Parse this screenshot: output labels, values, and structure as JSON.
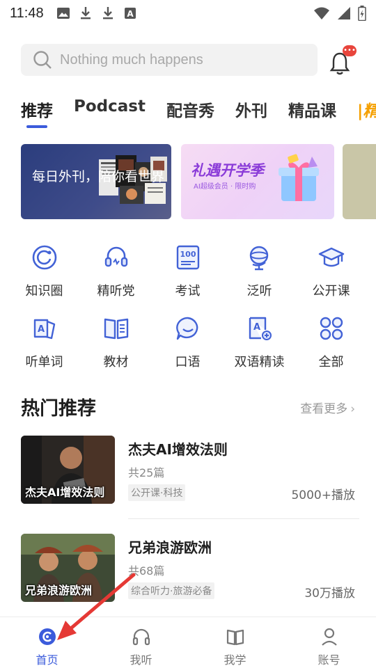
{
  "status_bar": {
    "time": "11:48",
    "icons": [
      "image-icon",
      "download-icon",
      "download-icon",
      "font-icon",
      "wifi-icon",
      "signal-icon",
      "battery-icon"
    ]
  },
  "search": {
    "placeholder": "Nothing much happens",
    "notification_badge": "•••"
  },
  "tabs": [
    {
      "label": "推荐",
      "active": true
    },
    {
      "label": "Podcast",
      "active": false
    },
    {
      "label": "配音秀",
      "active": false
    },
    {
      "label": "外刊",
      "active": false
    },
    {
      "label": "精品课",
      "active": false
    },
    {
      "label": "|精",
      "active": false
    }
  ],
  "banners": [
    {
      "title": "每日外刊，陪你看世界"
    },
    {
      "headline": "礼遇开学季",
      "sub": "AI超级会员 · 限时购"
    },
    {
      "partial": ""
    }
  ],
  "quick_grid": [
    {
      "label": "知识圈",
      "icon": "circle-refresh-icon"
    },
    {
      "label": "精听党",
      "icon": "headset-icon"
    },
    {
      "label": "考试",
      "icon": "score-100-icon"
    },
    {
      "label": "泛听",
      "icon": "globe-icon"
    },
    {
      "label": "公开课",
      "icon": "graduation-cap-icon"
    },
    {
      "label": "听单词",
      "icon": "word-card-icon"
    },
    {
      "label": "教材",
      "icon": "book-icon"
    },
    {
      "label": "口语",
      "icon": "speech-bubble-icon"
    },
    {
      "label": "双语精读",
      "icon": "bilingual-read-icon"
    },
    {
      "label": "全部",
      "icon": "four-leaf-icon"
    }
  ],
  "hot": {
    "title": "热门推荐",
    "more": "查看更多",
    "courses": [
      {
        "thumb_caption": "杰夫AI增效法则",
        "title": "杰夫AI增效法则",
        "count": "共25篇",
        "tag": "公开课·科技",
        "plays": "5000+播放"
      },
      {
        "thumb_caption": "兄弟浪游欧洲",
        "title": "兄弟浪游欧洲",
        "count": "共68篇",
        "tag": "综合听力·旅游必备",
        "plays": "30万播放"
      }
    ]
  },
  "bottom_nav": [
    {
      "label": "首页",
      "active": true
    },
    {
      "label": "我听",
      "active": false
    },
    {
      "label": "我学",
      "active": false
    },
    {
      "label": "账号",
      "active": false
    }
  ],
  "colors": {
    "accent": "#3b5bdb",
    "badge": "#e8453c",
    "annotation_arrow": "#e53935"
  }
}
